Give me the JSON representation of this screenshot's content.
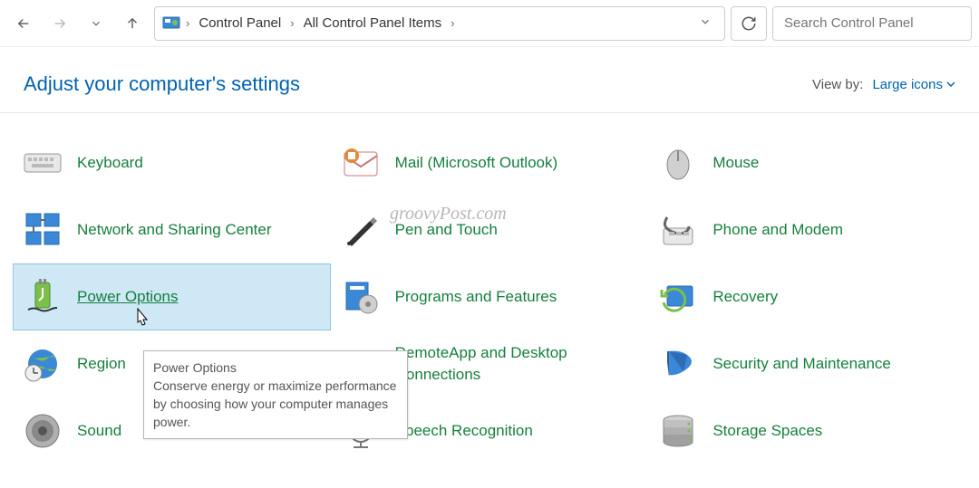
{
  "breadcrumb": {
    "items": [
      "Control Panel",
      "All Control Panel Items"
    ]
  },
  "search": {
    "placeholder": "Search Control Panel"
  },
  "header": {
    "title": "Adjust your computer's settings",
    "viewby_label": "View by:",
    "viewby_value": "Large icons"
  },
  "items": [
    {
      "icon": "keyboard",
      "label": "Keyboard"
    },
    {
      "icon": "mail",
      "label": "Mail (Microsoft Outlook)"
    },
    {
      "icon": "mouse",
      "label": "Mouse"
    },
    {
      "icon": "network",
      "label": "Network and Sharing Center"
    },
    {
      "icon": "pen",
      "label": "Pen and Touch"
    },
    {
      "icon": "phone",
      "label": "Phone and Modem"
    },
    {
      "icon": "power",
      "label": "Power Options",
      "hovered": true
    },
    {
      "icon": "programs",
      "label": "Programs and Features"
    },
    {
      "icon": "recovery",
      "label": "Recovery"
    },
    {
      "icon": "region",
      "label": "Region"
    },
    {
      "icon": "remoteapp",
      "label": "RemoteApp and Desktop Connections"
    },
    {
      "icon": "security",
      "label": "Security and Maintenance"
    },
    {
      "icon": "sound",
      "label": "Sound"
    },
    {
      "icon": "speech",
      "label": "Speech Recognition"
    },
    {
      "icon": "storage",
      "label": "Storage Spaces"
    }
  ],
  "tooltip": {
    "title": "Power Options",
    "body": "Conserve energy or maximize performance by choosing how your computer manages power."
  },
  "watermark": "groovyPost.com"
}
